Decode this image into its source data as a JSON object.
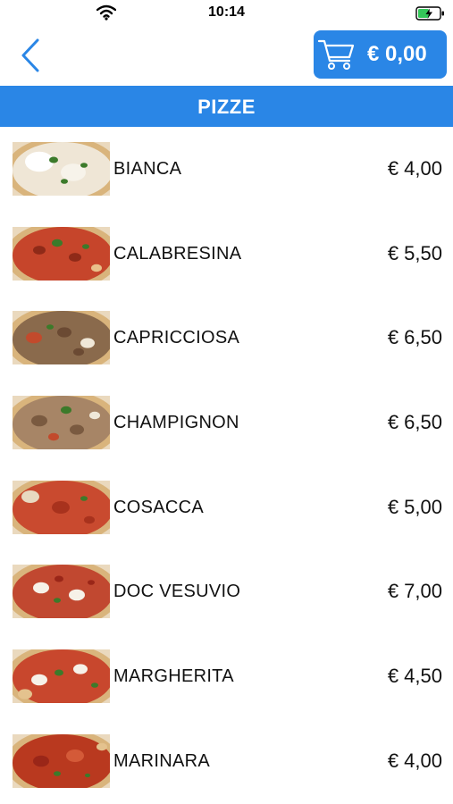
{
  "status_bar": {
    "time": "10:14",
    "wifi_icon": "wifi-icon",
    "battery_icon": "battery-charging-icon"
  },
  "nav": {
    "back_icon": "chevron-left-icon",
    "cart_icon": "shopping-cart-icon",
    "cart_total": "€ 0,00"
  },
  "section": {
    "title": "PIZZE"
  },
  "colors": {
    "accent": "#2a86e6",
    "header_text": "#ffffff"
  },
  "items": [
    {
      "name": "BIANCA",
      "price": "€ 4,00",
      "topping": "bianca"
    },
    {
      "name": "CALABRESINA",
      "price": "€ 5,50",
      "topping": "calabresina"
    },
    {
      "name": "CAPRICCIOSA",
      "price": "€ 6,50",
      "topping": "capricciosa"
    },
    {
      "name": "CHAMPIGNON",
      "price": "€ 6,50",
      "topping": "champignon"
    },
    {
      "name": "COSACCA",
      "price": "€ 5,00",
      "topping": "cosacca"
    },
    {
      "name": "DOC VESUVIO",
      "price": "€ 7,00",
      "topping": "doc-vesuvio"
    },
    {
      "name": "MARGHERITA",
      "price": "€ 4,50",
      "topping": "margherita"
    },
    {
      "name": "MARINARA",
      "price": "€ 4,00",
      "topping": "marinara"
    }
  ]
}
